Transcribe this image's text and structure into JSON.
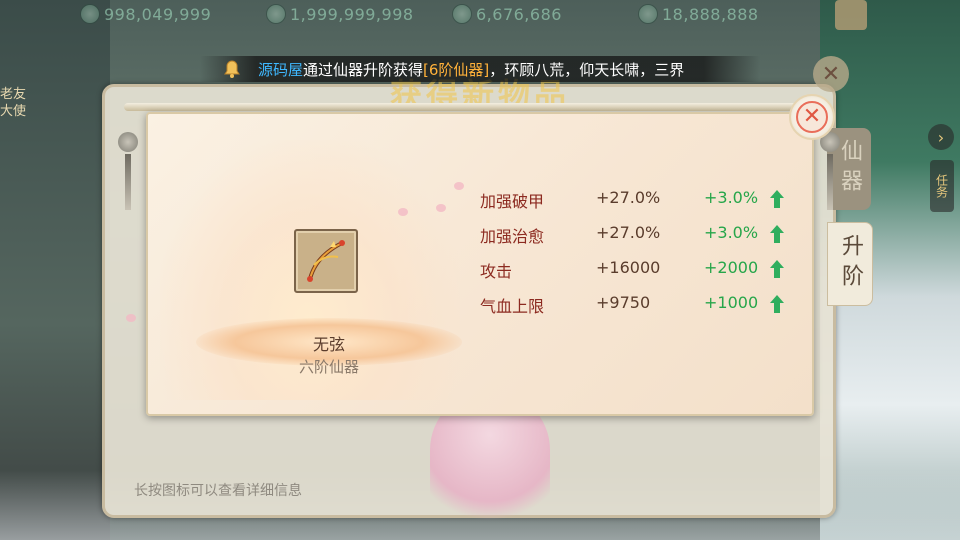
{
  "currencies": [
    {
      "icon": "silver-coin-icon",
      "value": "998,049,999"
    },
    {
      "icon": "ingot-icon",
      "value": "1,999,999,998"
    },
    {
      "icon": "jade-coin-icon",
      "value": "6,676,686"
    },
    {
      "icon": "gem-icon",
      "value": "18,888,888"
    }
  ],
  "left_name": {
    "line1": "老友",
    "line2": "大使"
  },
  "banner": {
    "player": "源码屋",
    "text_before": "通过仙器升阶获得",
    "item": "[6阶仙器]",
    "text_after": "，环顾八荒，仰天长啸，三界"
  },
  "outer_window": {
    "title": "获得新物品",
    "hint": "长按图标可以查看详细信息",
    "tab_upgrade": "升阶",
    "tab_other": "仙器",
    "task_button": "任务",
    "arrow": "›"
  },
  "item": {
    "name": "无弦",
    "tier": "六阶仙器"
  },
  "stats": [
    {
      "label": "加强破甲",
      "value": "+27.0%",
      "increase": "+3.0%"
    },
    {
      "label": "加强治愈",
      "value": "+27.0%",
      "increase": "+3.0%"
    },
    {
      "label": "攻击",
      "value": "+16000",
      "increase": "+2000"
    },
    {
      "label": "气血上限",
      "value": "+9750",
      "increase": "+1000"
    }
  ],
  "close_glyph": "✕",
  "colors": {
    "stat_label": "#8c2a20",
    "increase": "#26a64a",
    "player_name": "#3fb8ff",
    "item_name": "#ffb13a"
  }
}
